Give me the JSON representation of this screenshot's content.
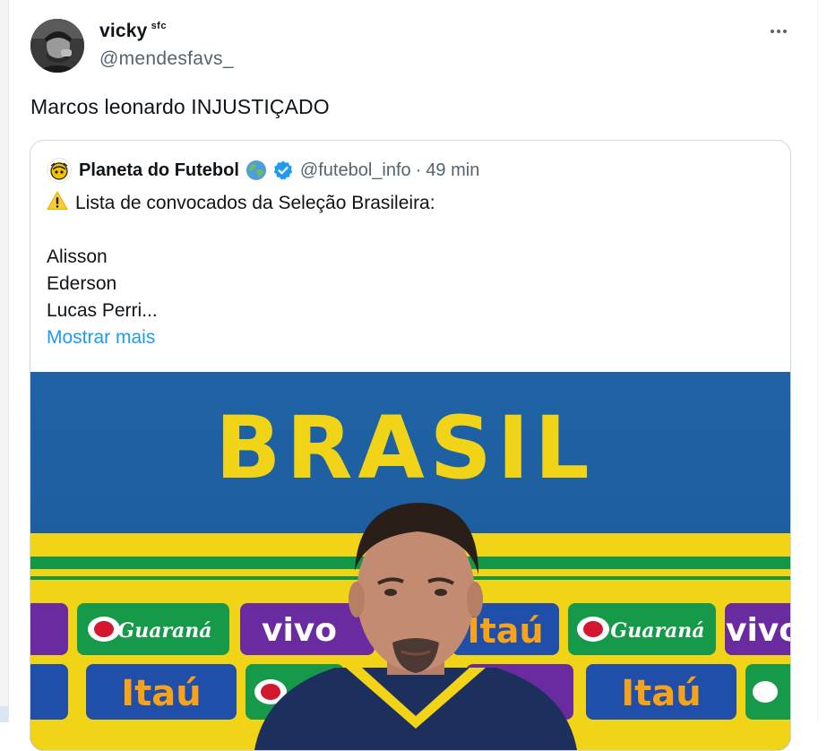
{
  "tweet": {
    "author": {
      "display_name": "vicky",
      "name_suffix": "sfc",
      "handle": "@mendesfavs_"
    },
    "text": "Marcos leonardo INJUSTIÇADO",
    "more_icon": "more-horizontal-icon"
  },
  "quoted_tweet": {
    "author": {
      "display_name": "Planeta do Futebol",
      "handle": "@futebol_info",
      "verified_color": "#1d9bf0"
    },
    "separator": "·",
    "time": "49 min",
    "lines": [
      "Lista de convocados da Seleção Brasileira:",
      "",
      "Alisson",
      "Ederson",
      "Lucas Perri..."
    ],
    "show_more": "Mostrar mais",
    "media": {
      "backdrop_text": "BRASIL",
      "sponsors": [
        "Guaraná",
        "vivo",
        "Itaú"
      ]
    }
  },
  "colors": {
    "accent": "#1d9bf0",
    "secondary_text": "#536471",
    "border": "#cfd9de",
    "brazil_blue": "#1c5fa0",
    "brazil_yellow": "#f1d318",
    "brazil_green": "#129647"
  }
}
